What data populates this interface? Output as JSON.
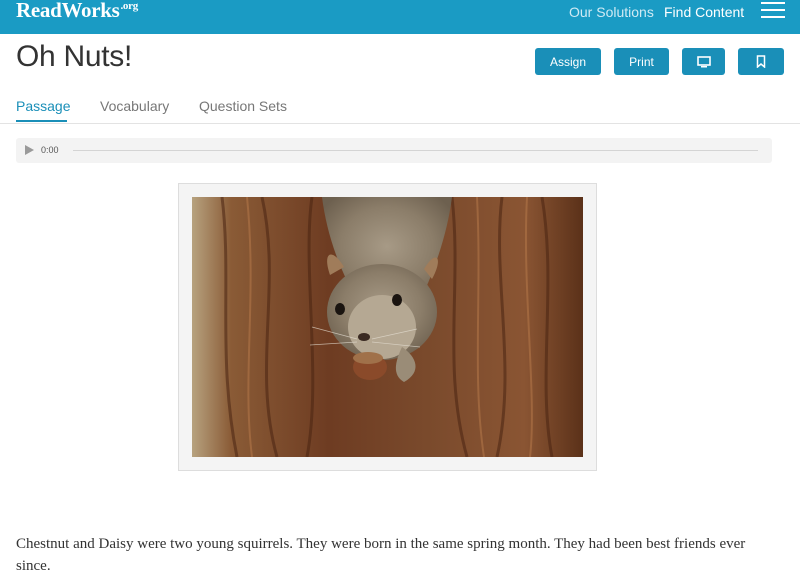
{
  "header": {
    "logo_text": "ReadWorks",
    "logo_suffix": ".org",
    "nav": [
      "Our Solutions",
      "Find Content"
    ],
    "menu_icon": "hamburger-icon"
  },
  "article": {
    "title": "Oh Nuts!",
    "actions": {
      "assign_label": "Assign",
      "print_label": "Print",
      "present_icon": "monitor-icon",
      "bookmark_icon": "bookmark-icon"
    }
  },
  "tabs": [
    {
      "label": "Passage",
      "active": true
    },
    {
      "label": "Vocabulary",
      "active": false
    },
    {
      "label": "Question Sets",
      "active": false
    }
  ],
  "audio": {
    "time": "0:00",
    "progress": 0
  },
  "image": {
    "subject": "squirrel on tree bark holding an acorn"
  },
  "passage": {
    "text": "Chestnut and Daisy were two young squirrels. They were born in the same spring month. They had been best friends ever since."
  },
  "colors": {
    "brand": "#1a9bc4",
    "button": "#1a8fb8",
    "tab_active": "#1a8fb8"
  }
}
